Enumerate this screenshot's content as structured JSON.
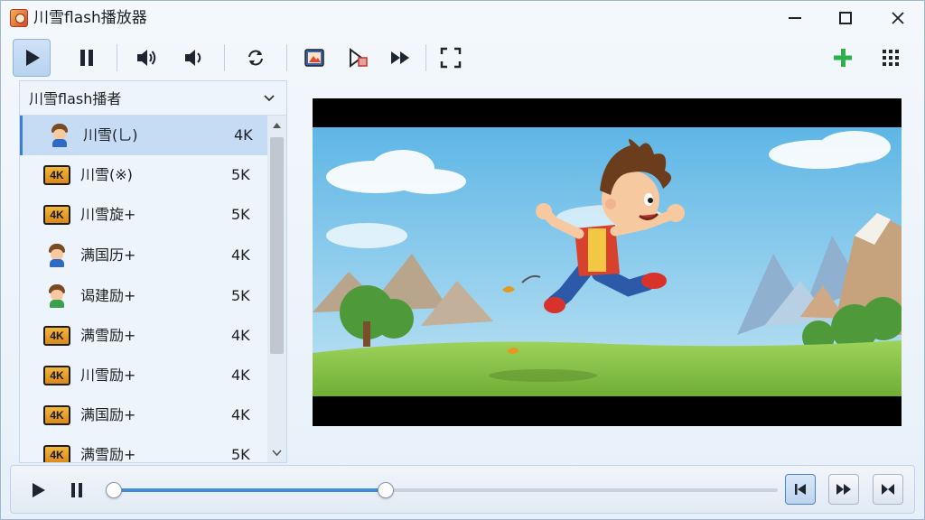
{
  "window": {
    "title": "川雪flash播放器",
    "controls": {
      "minimize": "minimize-icon",
      "maximize": "maximize-icon",
      "close": "close-icon"
    }
  },
  "toolbar": {
    "buttons": [
      {
        "name": "play-button",
        "icon": "play-icon",
        "active": true
      },
      {
        "name": "pause-button",
        "icon": "pause-icon",
        "active": false
      },
      {
        "name": "volume-up-button",
        "icon": "volume-high-icon",
        "active": false
      },
      {
        "name": "volume-down-button",
        "icon": "volume-low-icon",
        "active": false
      },
      {
        "name": "rotate-button",
        "icon": "rotate-icon",
        "active": false
      },
      {
        "name": "snapshot-button",
        "icon": "image-icon",
        "active": false
      },
      {
        "name": "frame-step-button",
        "icon": "frame-step-icon",
        "active": false
      },
      {
        "name": "fast-forward-button",
        "icon": "fast-forward-icon",
        "active": false
      },
      {
        "name": "fullscreen-button",
        "icon": "fullscreen-icon",
        "active": false
      },
      {
        "name": "add-button",
        "icon": "plus-icon",
        "active": false
      },
      {
        "name": "grid-menu-button",
        "icon": "grid-icon",
        "active": false
      }
    ],
    "add_color": "#2bb24c"
  },
  "sidebar": {
    "header": "川雪flash播者",
    "items": [
      {
        "name": "川雪(乚)",
        "size": "4K",
        "thumb": "avatar",
        "selected": true
      },
      {
        "name": "川雪(※)",
        "size": "5K",
        "thumb": "4k-badge",
        "selected": false
      },
      {
        "name": "川雪旋+",
        "size": "5K",
        "thumb": "4k-badge",
        "selected": false
      },
      {
        "name": "满国历+",
        "size": "4K",
        "thumb": "avatar",
        "selected": false
      },
      {
        "name": "谒建励+",
        "size": "5K",
        "thumb": "avatar",
        "selected": false
      },
      {
        "name": "满雪励+",
        "size": "4K",
        "thumb": "4k-badge",
        "selected": false
      },
      {
        "name": "川雪励+",
        "size": "4K",
        "thumb": "4k-badge",
        "selected": false
      },
      {
        "name": "满国励+",
        "size": "4K",
        "thumb": "4k-badge",
        "selected": false
      },
      {
        "name": "满雪励+",
        "size": "5K",
        "thumb": "4k-badge",
        "selected": false
      }
    ],
    "badge_text": "4K",
    "scroll_position": 0.0
  },
  "player": {
    "progress": 0.41,
    "accent": "#3f8ce0",
    "scene": "cartoon-boy-running-landscape"
  },
  "bottom": {
    "play": "play-icon",
    "pause": "pause-icon",
    "prev": "skip-back-icon",
    "next": "skip-forward-icon",
    "loop": "loop-icon"
  }
}
